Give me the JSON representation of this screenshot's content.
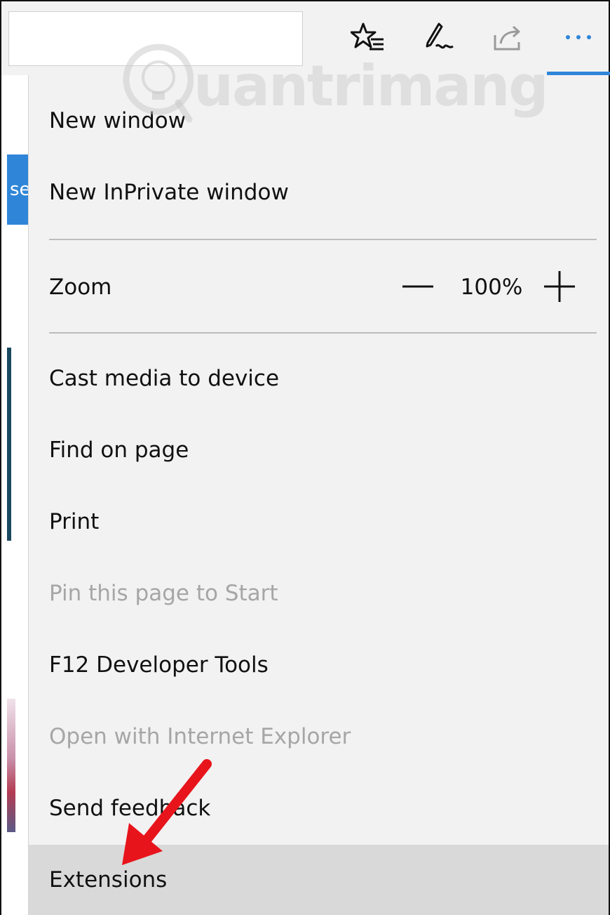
{
  "toolbar": {
    "address_value": "",
    "icons": [
      "favorites-list-icon",
      "web-note-icon",
      "share-icon",
      "more-actions-icon"
    ],
    "more_label": "···",
    "accent_color": "#2f86d8"
  },
  "page_behind": {
    "button_fragment": "se"
  },
  "menu": {
    "items": [
      {
        "label": "New window"
      },
      {
        "label": "New InPrivate window"
      },
      {
        "label": "Cast media to device"
      },
      {
        "label": "Find on page"
      },
      {
        "label": "Print"
      },
      {
        "label": "Pin this page to Start",
        "disabled": true
      },
      {
        "label": "F12 Developer Tools"
      },
      {
        "label": "Open with Internet Explorer",
        "disabled": true
      },
      {
        "label": "Send feedback"
      },
      {
        "label": "Extensions",
        "highlighted": true
      }
    ],
    "zoom": {
      "label": "Zoom",
      "value": "100%"
    }
  },
  "watermark": {
    "text": "uantrimang"
  }
}
